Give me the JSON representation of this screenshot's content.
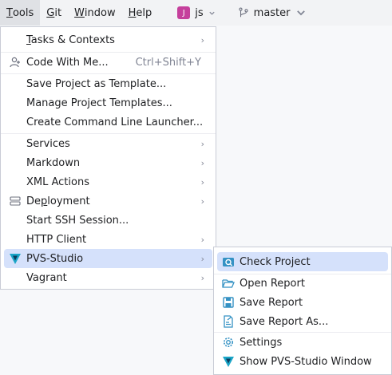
{
  "menubar": {
    "items": [
      {
        "label": "Tools",
        "mnemonic": "T",
        "rest": "ools",
        "active": true
      },
      {
        "label": "Git",
        "mnemonic": "G",
        "rest": "it"
      },
      {
        "label": "Window",
        "mnemonic": "W",
        "rest": "indow"
      },
      {
        "label": "Help",
        "mnemonic": "H",
        "rest": "elp"
      }
    ],
    "project": {
      "badge": "J",
      "name": "js"
    },
    "branch": {
      "name": "master"
    }
  },
  "tools_menu": {
    "items": [
      {
        "pre": "",
        "mn": "T",
        "post": "asks & Contexts",
        "submenu": true
      },
      {
        "label": "Code With Me...",
        "shortcut": "Ctrl+Shift+Y",
        "icon": "person-add-icon"
      },
      {
        "label": "Save Project as Template..."
      },
      {
        "label": "Manage Project Templates..."
      },
      {
        "label": "Create Command Line Launcher..."
      },
      {
        "label": "Services",
        "submenu": true
      },
      {
        "label": "Markdown",
        "submenu": true
      },
      {
        "label": "XML Actions",
        "submenu": true
      },
      {
        "pre": "De",
        "mn": "p",
        "post": "loyment",
        "submenu": true,
        "icon": "server-icon"
      },
      {
        "label": "Start SSH Session..."
      },
      {
        "label": "HTTP Client",
        "submenu": true
      },
      {
        "label": "PVS-Studio",
        "submenu": true,
        "icon": "pvs-studio-icon",
        "selected": true
      },
      {
        "label": "Vagrant",
        "submenu": true
      }
    ],
    "submenu_arrow": "›"
  },
  "pvs_menu": {
    "items": [
      {
        "label": "Check Project",
        "icon": "check-project-icon",
        "selected": true
      },
      {
        "label": "Open Report",
        "icon": "folder-open-icon"
      },
      {
        "label": "Save Report",
        "icon": "save-icon"
      },
      {
        "label": "Save Report As...",
        "icon": "save-as-icon"
      },
      {
        "label": "Settings",
        "icon": "gear-icon"
      },
      {
        "label": "Show PVS-Studio Window",
        "icon": "pvs-studio-icon"
      }
    ]
  },
  "colors": {
    "selection": "#d5e1fb",
    "accent_blue": "#3574f0",
    "pvs_teal": "#1aa5c7",
    "project_badge": "#c53f9c"
  }
}
